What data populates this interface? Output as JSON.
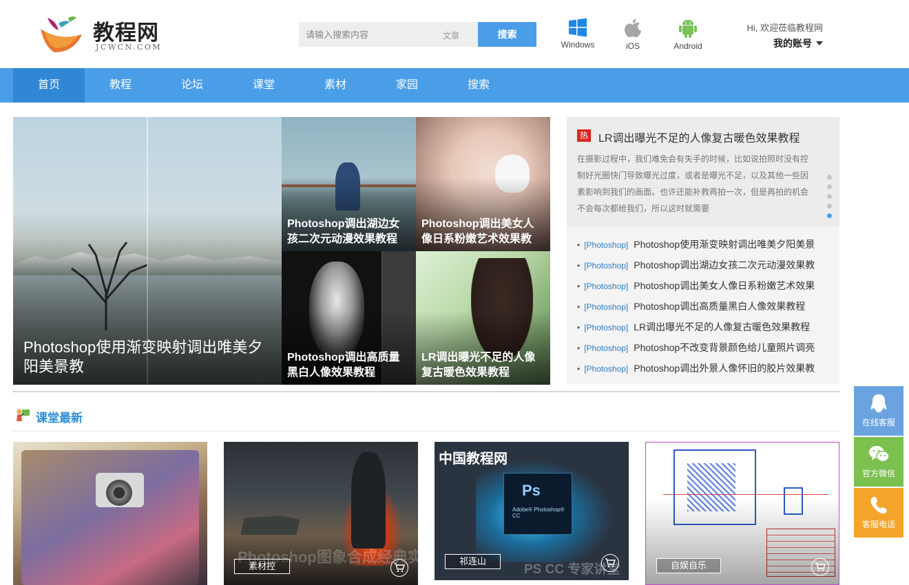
{
  "header": {
    "logo_name": "教程网",
    "logo_sub": "JCWCN.COM",
    "search_placeholder": "请输入搜索内容",
    "search_type": "文章",
    "search_button": "搜索",
    "platforms": [
      {
        "label": "Windows",
        "icon": "windows-icon"
      },
      {
        "label": "iOS",
        "icon": "apple-icon"
      },
      {
        "label": "Android",
        "icon": "android-icon"
      }
    ],
    "greeting": "Hi, 欢迎莅临教程网",
    "account": "我的账号"
  },
  "nav": {
    "items": [
      "首页",
      "教程",
      "论坛",
      "课堂",
      "素材",
      "家园",
      "搜索"
    ],
    "active_index": 0
  },
  "slider": {
    "tiles": [
      {
        "caption": "Photoshop使用渐变映射调出唯美夕阳美景教"
      },
      {
        "caption": "Photoshop调出湖边女孩二次元动漫效果教程"
      },
      {
        "caption": "Photoshop调出美女人像日系粉嫩艺术效果教"
      },
      {
        "caption": "Photoshop调出高质量黑白人像效果教程"
      },
      {
        "caption": "LR调出曝光不足的人像复古暖色效果教程"
      }
    ]
  },
  "hot": {
    "badge": "热",
    "title": "LR调出曝光不足的人像复古暖色效果教程",
    "desc": "在摄影过程中，我们难免会有失手的时候，比如说拍照时没有控制好光圈快门导致曝光过度，或者是曝光不足，以及其他一些因素影响到我们的画面。也许还能补救再拍一次，但是再拍的机会不会每次都给我们，所以这时就需要",
    "list": [
      {
        "tag": "[Photoshop]",
        "title": "Photoshop使用渐变映射调出唯美夕阳美景"
      },
      {
        "tag": "[Photoshop]",
        "title": "Photoshop调出湖边女孩二次元动漫效果教"
      },
      {
        "tag": "[Photoshop]",
        "title": "Photoshop调出美女人像日系粉嫩艺术效果"
      },
      {
        "tag": "[Photoshop]",
        "title": "Photoshop调出高质量黑白人像效果教程"
      },
      {
        "tag": "[Photoshop]",
        "title": "LR调出曝光不足的人像复古暖色效果教程"
      },
      {
        "tag": "[Photoshop]",
        "title": "Photoshop不改变背景颜色给儿童照片调亮"
      },
      {
        "tag": "[Photoshop]",
        "title": "Photoshop调出外景人像怀旧的胶片效果教"
      }
    ]
  },
  "section": {
    "title": "课堂最新"
  },
  "cards": [
    {
      "label": ""
    },
    {
      "label": "素材控",
      "watermark": "Photoshop图象合成经典实例"
    },
    {
      "label": "祁连山",
      "brand": "中国教程网",
      "ps_text": "Ps",
      "ps_sub": "Adobe® Photoshop® CC",
      "watermark": "PS CC 专家讲堂"
    },
    {
      "label": "自娱自乐"
    }
  ],
  "side": {
    "service": "在线客服",
    "wechat": "官方微信",
    "phone": "客服电话"
  },
  "colors": {
    "accent": "#4a9ee8",
    "nav_active": "#2f87d6",
    "hot_red": "#d9251d"
  }
}
